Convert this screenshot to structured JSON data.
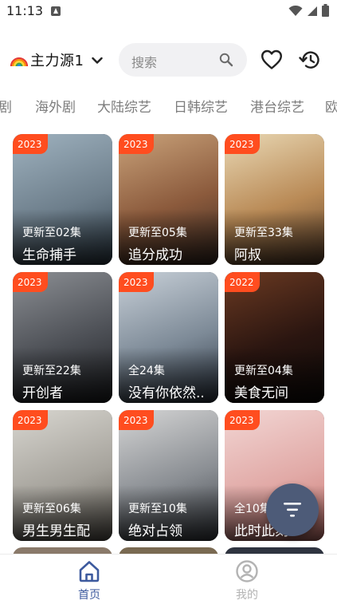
{
  "status_bar": {
    "time": "11:13"
  },
  "header": {
    "source_label": "主力源1",
    "search_placeholder": "搜索"
  },
  "category_tabs": [
    "剧",
    "海外剧",
    "大陆综艺",
    "日韩综艺",
    "港台综艺",
    "欧"
  ],
  "cards": [
    {
      "year": "2023",
      "episodes": "更新至02集",
      "title": "生命捕手",
      "colors": [
        "#9fb2bf",
        "#6e7f8c",
        "#2f3d48"
      ]
    },
    {
      "year": "2023",
      "episodes": "更新至05集",
      "title": "追分成功",
      "colors": [
        "#c9a27a",
        "#8b5a3c",
        "#3a2a22"
      ]
    },
    {
      "year": "2023",
      "episodes": "更新至33集",
      "title": "阿叔",
      "colors": [
        "#e9d8b4",
        "#b98a56",
        "#5a3f2a"
      ]
    },
    {
      "year": "2023",
      "episodes": "更新至22集",
      "title": "开创者",
      "colors": [
        "#8c8f94",
        "#4c4f55",
        "#1e1f22"
      ]
    },
    {
      "year": "2023",
      "episodes": "全24集",
      "title": "没有你依然..",
      "colors": [
        "#c8d0d8",
        "#7d8a97",
        "#2e3743"
      ]
    },
    {
      "year": "2022",
      "episodes": "更新至04集",
      "title": "美食无间",
      "colors": [
        "#6b3a22",
        "#2a1510",
        "#0e0a08"
      ]
    },
    {
      "year": "2023",
      "episodes": "更新至06集",
      "title": "男生男生配",
      "colors": [
        "#d8d6d0",
        "#a6a39c",
        "#5e5a52"
      ]
    },
    {
      "year": "2023",
      "episodes": "更新至10集",
      "title": "绝对占领",
      "colors": [
        "#d5d5d5",
        "#8a8e93",
        "#3b3f45"
      ]
    },
    {
      "year": "2023",
      "episodes": "全10集",
      "title": "此时此刻",
      "colors": [
        "#f2d6d4",
        "#e1a9a6",
        "#c97670"
      ]
    }
  ],
  "bottom_nav": {
    "home_label": "首页",
    "mine_label": "我的",
    "active_color": "#3d5a9e",
    "inactive_color": "#b3b3b3"
  }
}
